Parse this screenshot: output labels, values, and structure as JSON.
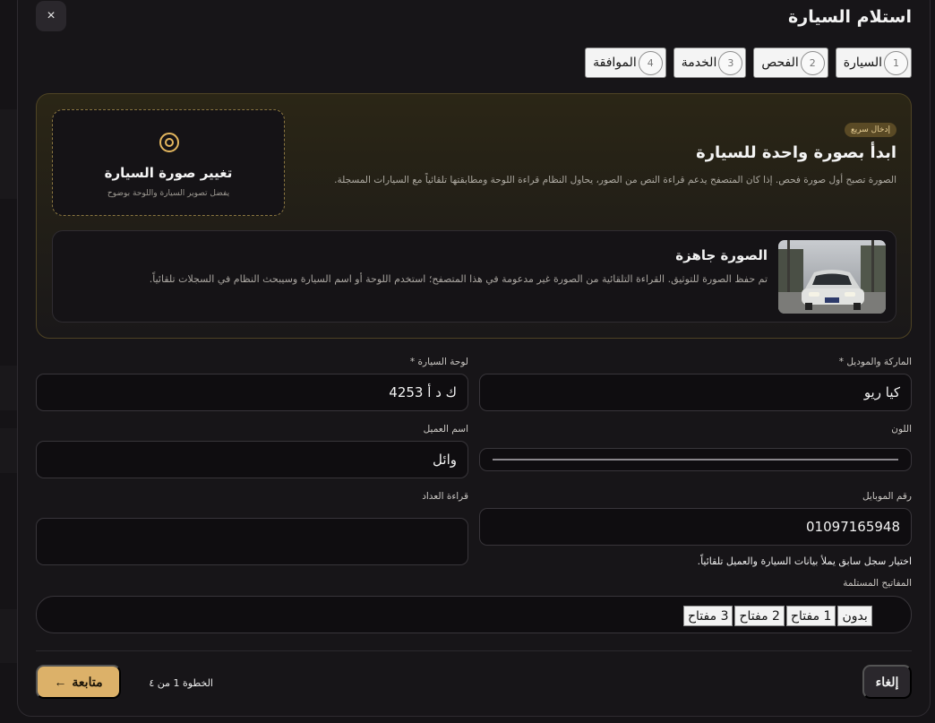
{
  "modal": {
    "title": "استلام السيارة",
    "close_label": "×"
  },
  "steps": [
    {
      "num": "1",
      "label": "السيارة"
    },
    {
      "num": "2",
      "label": "الفحص"
    },
    {
      "num": "3",
      "label": "الخدمة"
    },
    {
      "num": "4",
      "label": "الموافقة"
    }
  ],
  "quick_entry": {
    "badge": "إدخال سريع",
    "title": "ابدأ بصورة واحدة للسيارة",
    "description": "الصورة تصبح أول صورة فحص. إذا كان المتصفح يدعم قراءة النص من الصور، يحاول النظام قراءة اللوحة ومطابقتها تلقائياً مع السيارات المسجلة."
  },
  "upload": {
    "icon": "target-icon",
    "title": "تغيير صورة السيارة",
    "subtitle": "يفضل تصوير السيارة واللوحة بوضوح"
  },
  "photo_ready": {
    "title": "الصورة جاهزة",
    "description": "تم حفظ الصورة للتوثيق. القراءة التلقائية من الصورة غير مدعومة في هذا المتصفح؛ استخدم اللوحة أو اسم السيارة وسيبحث النظام في السجلات تلقائياً."
  },
  "form": {
    "brand_label": "الماركة والموديل *",
    "brand_value": "كيا ريو",
    "plate_label": "لوحة السيارة *",
    "plate_value": "ك د أ 4253",
    "color_label": "اللون",
    "customer_label": "اسم العميل",
    "customer_value": "وائل",
    "mobile_label": "رقم الموبايل",
    "mobile_value": "01097165948",
    "odometer_label": "قراءة العداد",
    "odometer_value": "",
    "hint": "اختيار سجل سابق يملأ بيانات السيارة والعميل تلقائياً.",
    "keys_label": "المفاتيح المستلمة",
    "keys_options": [
      "بدون",
      "1 مفتاح",
      "2 مفتاح",
      "3 مفتاح"
    ]
  },
  "footer": {
    "cancel": "إلغاء",
    "step_count": "الخطوة 1 من ٤",
    "continue": "متابعة",
    "continue_arrow": "←"
  },
  "colors": {
    "accent": "#dcb169",
    "panel_border": "#4e4324",
    "background": "#171518"
  }
}
